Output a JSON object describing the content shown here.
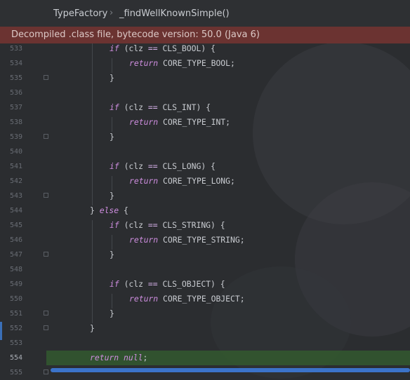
{
  "breadcrumb": {
    "items": [
      "TypeFactory",
      "_findWellKnownSimple()"
    ],
    "separator": "›"
  },
  "banner": {
    "text": "Decompiled .class file, bytecode version: 50.0 (Java 6)"
  },
  "editor": {
    "current_line": "554",
    "lines": [
      {
        "num": "533",
        "indent": 1,
        "tokens": [
          [
            "kw",
            "if"
          ],
          [
            "pl",
            " (clz "
          ],
          [
            "op",
            "=="
          ],
          [
            "pl",
            " CLS_BOOL) {"
          ]
        ]
      },
      {
        "num": "534",
        "indent": 2,
        "tokens": [
          [
            "kw",
            "return"
          ],
          [
            "pl",
            " CORE_TYPE_BOOL;"
          ]
        ]
      },
      {
        "num": "535",
        "indent": 1,
        "tokens": [
          [
            "pl",
            "}"
          ]
        ]
      },
      {
        "num": "536",
        "indent": 0,
        "tokens": []
      },
      {
        "num": "537",
        "indent": 1,
        "tokens": [
          [
            "kw",
            "if"
          ],
          [
            "pl",
            " (clz "
          ],
          [
            "op",
            "=="
          ],
          [
            "pl",
            " CLS_INT) {"
          ]
        ]
      },
      {
        "num": "538",
        "indent": 2,
        "tokens": [
          [
            "kw",
            "return"
          ],
          [
            "pl",
            " CORE_TYPE_INT;"
          ]
        ]
      },
      {
        "num": "539",
        "indent": 1,
        "tokens": [
          [
            "pl",
            "}"
          ]
        ]
      },
      {
        "num": "540",
        "indent": 0,
        "tokens": []
      },
      {
        "num": "541",
        "indent": 1,
        "tokens": [
          [
            "kw",
            "if"
          ],
          [
            "pl",
            " (clz "
          ],
          [
            "op",
            "=="
          ],
          [
            "pl",
            " CLS_LONG) {"
          ]
        ]
      },
      {
        "num": "542",
        "indent": 2,
        "tokens": [
          [
            "kw",
            "return"
          ],
          [
            "pl",
            " CORE_TYPE_LONG;"
          ]
        ]
      },
      {
        "num": "543",
        "indent": 1,
        "tokens": [
          [
            "pl",
            "}"
          ]
        ]
      },
      {
        "num": "544",
        "indent": 0,
        "tokens": [
          [
            "pl",
            "} "
          ],
          [
            "kw",
            "else"
          ],
          [
            "pl",
            " {"
          ]
        ]
      },
      {
        "num": "545",
        "indent": 1,
        "tokens": [
          [
            "kw",
            "if"
          ],
          [
            "pl",
            " (clz "
          ],
          [
            "op",
            "=="
          ],
          [
            "pl",
            " CLS_STRING) {"
          ]
        ]
      },
      {
        "num": "546",
        "indent": 2,
        "tokens": [
          [
            "kw",
            "return"
          ],
          [
            "pl",
            " CORE_TYPE_STRING;"
          ]
        ]
      },
      {
        "num": "547",
        "indent": 1,
        "tokens": [
          [
            "pl",
            "}"
          ]
        ]
      },
      {
        "num": "548",
        "indent": 0,
        "tokens": []
      },
      {
        "num": "549",
        "indent": 1,
        "tokens": [
          [
            "kw",
            "if"
          ],
          [
            "pl",
            " (clz "
          ],
          [
            "op",
            "=="
          ],
          [
            "pl",
            " CLS_OBJECT) {"
          ]
        ]
      },
      {
        "num": "550",
        "indent": 2,
        "tokens": [
          [
            "kw",
            "return"
          ],
          [
            "pl",
            " CORE_TYPE_OBJECT;"
          ]
        ]
      },
      {
        "num": "551",
        "indent": 1,
        "tokens": [
          [
            "pl",
            "}"
          ]
        ]
      },
      {
        "num": "552",
        "indent": 0,
        "tokens": [
          [
            "pl",
            "}"
          ]
        ]
      },
      {
        "num": "553",
        "indent": 0,
        "tokens": []
      },
      {
        "num": "554",
        "indent": 0,
        "tokens": [
          [
            "kw",
            "return"
          ],
          [
            "pl",
            " "
          ],
          [
            "kw",
            "null"
          ],
          [
            "pl",
            ";"
          ]
        ]
      },
      {
        "num": "555",
        "indent": 0,
        "tokens": []
      }
    ],
    "fold_lines": [
      "535",
      "539",
      "543",
      "547",
      "551",
      "552",
      "555"
    ]
  },
  "colors": {
    "background": "#2b2d30",
    "banner": "#6b3331",
    "keyword": "#cf8ee0",
    "current_line": "#33592f",
    "scrollbar": "#3b73c9"
  }
}
